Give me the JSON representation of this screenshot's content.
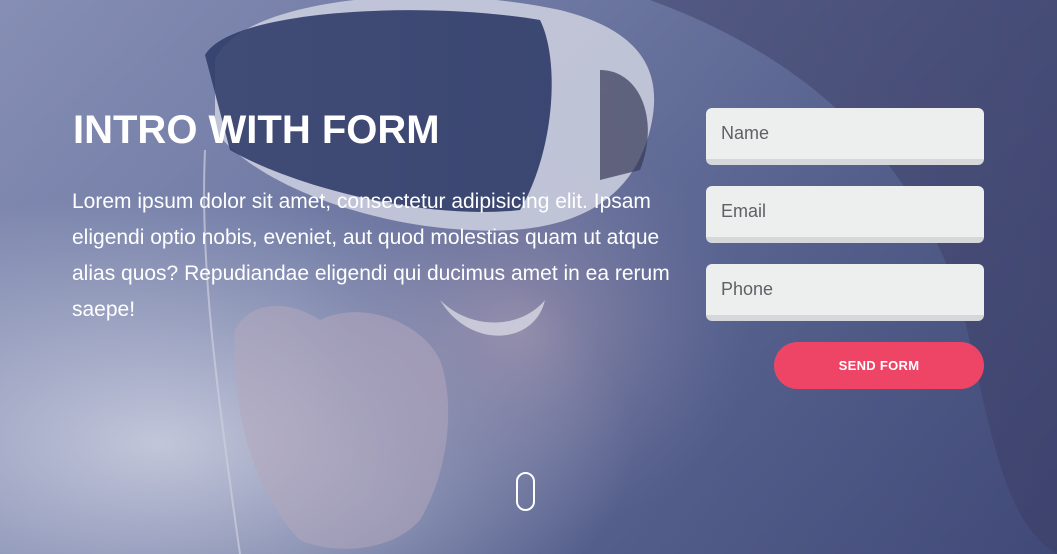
{
  "hero": {
    "title": "INTRO WITH FORM",
    "description": "Lorem ipsum dolor sit amet, consectetur adipisicing elit. Ipsam eligendi optio nobis, eveniet, aut quod molestias quam ut atque alias quos? Repudiandae eligendi qui ducimus amet in ea rerum saepe!"
  },
  "form": {
    "name_placeholder": "Name",
    "email_placeholder": "Email",
    "phone_placeholder": "Phone",
    "submit_label": "SEND FORM"
  },
  "colors": {
    "accent": "#ee4566",
    "field_bg": "#edeeee",
    "text": "#ffffff"
  },
  "icons": {
    "scroll": "scroll-mouse-icon"
  }
}
